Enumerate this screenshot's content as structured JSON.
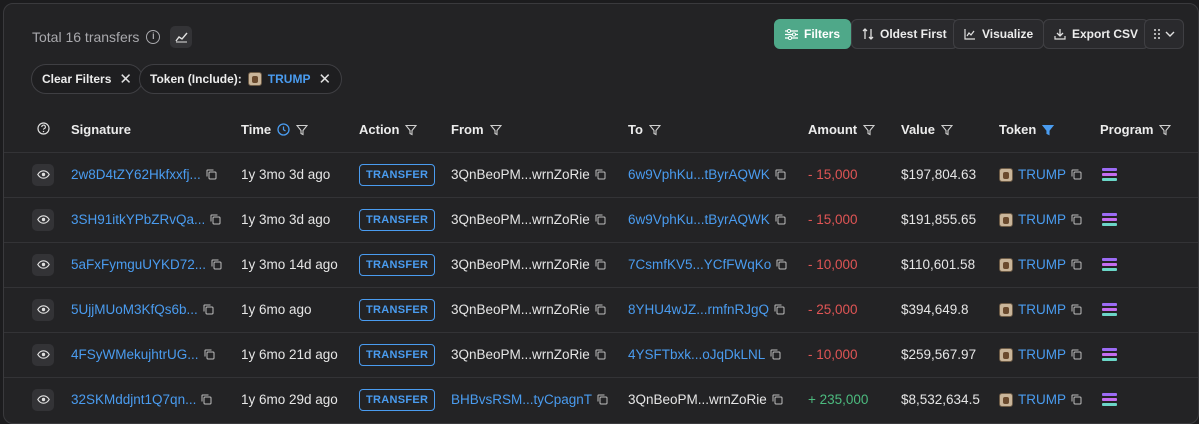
{
  "header": {
    "total_label": "Total 16 transfers",
    "buttons": {
      "filters": "Filters",
      "sort": "Oldest First",
      "visualize": "Visualize",
      "export": "Export CSV"
    }
  },
  "chips": {
    "clear": "Clear Filters",
    "token_prefix": "Token (Include):",
    "token_value": "TRUMP"
  },
  "columns": [
    "Signature",
    "Time",
    "Action",
    "From",
    "To",
    "Amount",
    "Value",
    "Token",
    "Program"
  ],
  "rows": [
    {
      "signature": "2w8D4tZY62Hkfxxfj...",
      "time": "1y 3mo 3d ago",
      "action": "TRANSFER",
      "from": "3QnBeoPM...wrnZoRie",
      "to": "6w9VphKu...tByrAQWK",
      "amount": "- 15,000",
      "value": "$197,804.63",
      "token": "TRUMP",
      "from_link": false,
      "to_link": true,
      "amount_sign": "neg"
    },
    {
      "signature": "3SH91itkYPbZRvQa...",
      "time": "1y 3mo 3d ago",
      "action": "TRANSFER",
      "from": "3QnBeoPM...wrnZoRie",
      "to": "6w9VphKu...tByrAQWK",
      "amount": "- 15,000",
      "value": "$191,855.65",
      "token": "TRUMP",
      "from_link": false,
      "to_link": true,
      "amount_sign": "neg"
    },
    {
      "signature": "5aFxFymguUYKD72...",
      "time": "1y 3mo 14d ago",
      "action": "TRANSFER",
      "from": "3QnBeoPM...wrnZoRie",
      "to": "7CsmfKV5...YCfFWqKo",
      "amount": "- 10,000",
      "value": "$110,601.58",
      "token": "TRUMP",
      "from_link": false,
      "to_link": true,
      "amount_sign": "neg"
    },
    {
      "signature": "5UjjMUoM3KfQs6b...",
      "time": "1y 6mo ago",
      "action": "TRANSFER",
      "from": "3QnBeoPM...wrnZoRie",
      "to": "8YHU4wJZ...rmfnRJgQ",
      "amount": "- 25,000",
      "value": "$394,649.8",
      "token": "TRUMP",
      "from_link": false,
      "to_link": true,
      "amount_sign": "neg"
    },
    {
      "signature": "4FSyWMekujhtrUG...",
      "time": "1y 6mo 21d ago",
      "action": "TRANSFER",
      "from": "3QnBeoPM...wrnZoRie",
      "to": "4YSFTbxk...oJqDkLNL",
      "amount": "- 10,000",
      "value": "$259,567.97",
      "token": "TRUMP",
      "from_link": false,
      "to_link": true,
      "amount_sign": "neg"
    },
    {
      "signature": "32SKMddjnt1Q7qn...",
      "time": "1y 6mo 29d ago",
      "action": "TRANSFER",
      "from": "BHBvsRSM...tyCpagnT",
      "to": "3QnBeoPM...wrnZoRie",
      "amount": "+ 235,000",
      "value": "$8,532,634.5",
      "token": "TRUMP",
      "from_link": true,
      "to_link": false,
      "amount_sign": "pos"
    }
  ],
  "colors": {
    "accent_green": "#4fa889",
    "link_blue": "#4a9cf0",
    "negative_red": "#e05555",
    "positive_green": "#4cbb7f"
  }
}
